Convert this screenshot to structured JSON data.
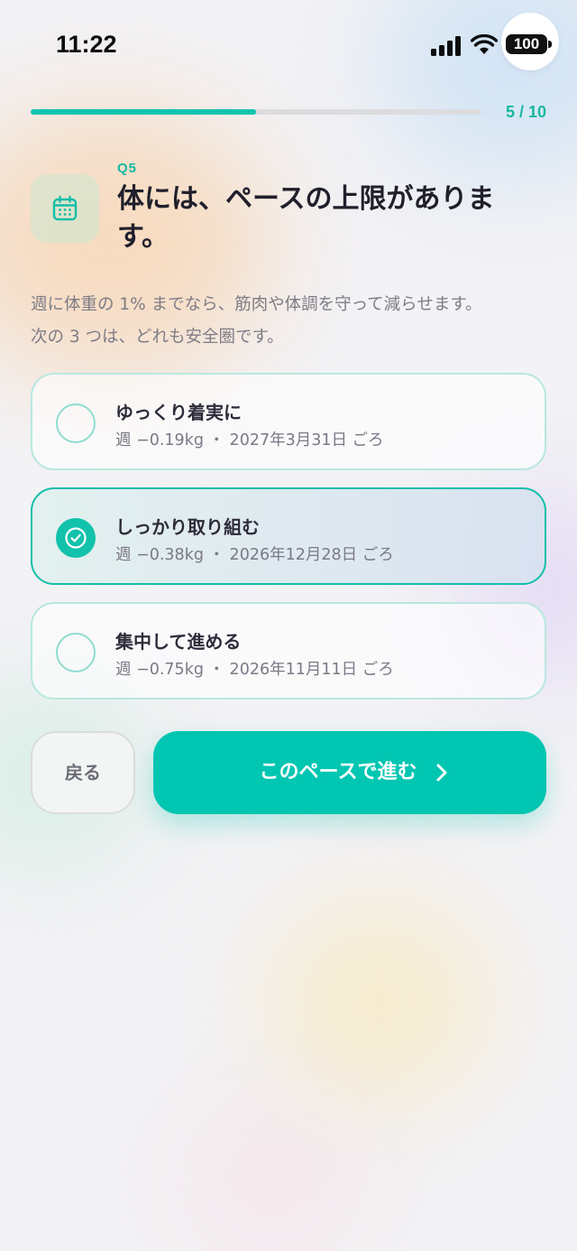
{
  "status_bar": {
    "time": "11:22",
    "battery": "100"
  },
  "progress": {
    "fraction": 0.5,
    "label": "5 / 10"
  },
  "question": {
    "number": "Q5",
    "title": "体には、ペースの上限があります。",
    "description_line1": "週に体重の 1% までなら、筋肉や体調を守って減らせます。",
    "description_line2": "次の 3 つは、どれも安全圏です。",
    "icon": "calendar-icon"
  },
  "options": [
    {
      "title": "ゆっくり着実に",
      "subtitle": "週 −0.19kg ・ 2027年3月31日 ごろ",
      "selected": false
    },
    {
      "title": "しっかり取り組む",
      "subtitle": "週 −0.38kg ・ 2026年12月28日 ごろ",
      "selected": true
    },
    {
      "title": "集中して進める",
      "subtitle": "週 −0.75kg ・ 2026年11月11日 ごろ",
      "selected": false
    }
  ],
  "buttons": {
    "back": "戻る",
    "next": "このペースで進む"
  },
  "colors": {
    "accent": "#01c6b1",
    "accent_text": "#19b8a2"
  }
}
